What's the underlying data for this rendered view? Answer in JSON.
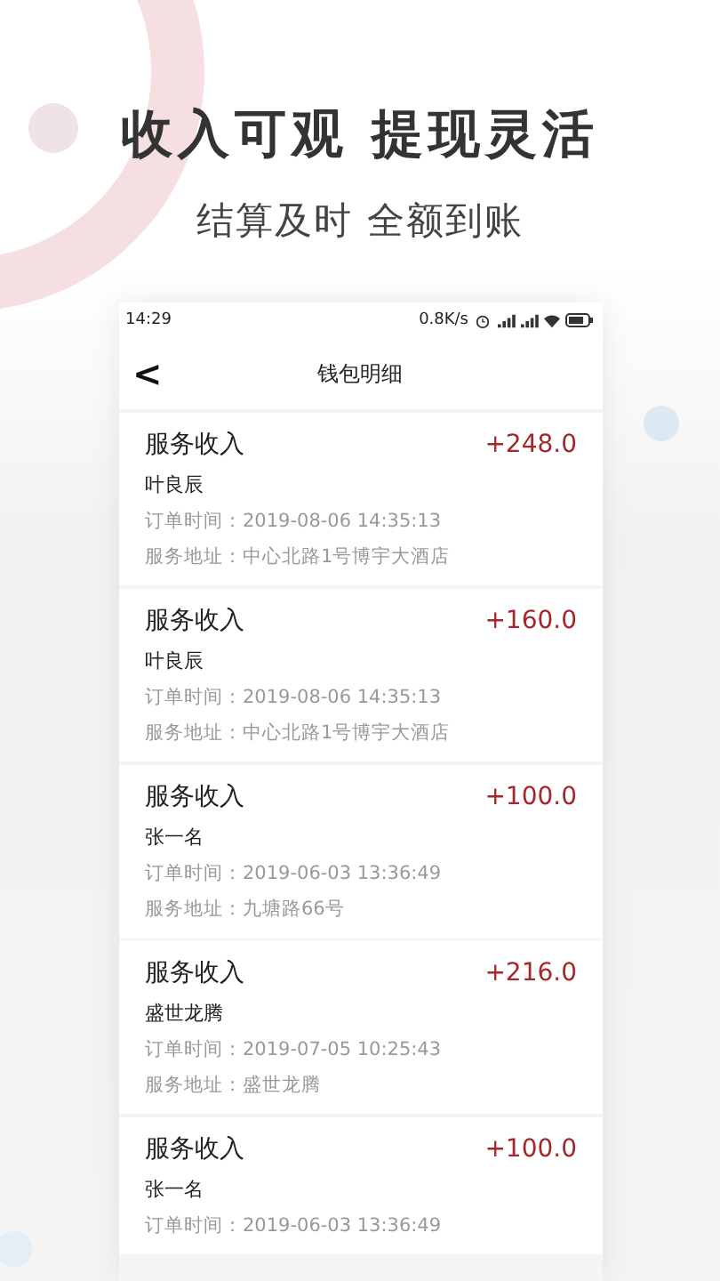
{
  "headline": "收入可观 提现灵活",
  "subheadline": "结算及时 全额到账",
  "status_bar": {
    "time": "14:29",
    "speed": "0.8K/s"
  },
  "nav": {
    "back": "<",
    "title": "钱包明细"
  },
  "records": [
    {
      "type": "服务收入",
      "amount": "+248.0",
      "name": "叶良辰",
      "time": "订单时间：2019-08-06 14:35:13",
      "address": "服务地址：中心北路1号博宇大酒店"
    },
    {
      "type": "服务收入",
      "amount": "+160.0",
      "name": "叶良辰",
      "time": "订单时间：2019-08-06 14:35:13",
      "address": "服务地址：中心北路1号博宇大酒店"
    },
    {
      "type": "服务收入",
      "amount": "+100.0",
      "name": "张一名",
      "time": "订单时间：2019-06-03 13:36:49",
      "address": "服务地址：九塘路66号"
    },
    {
      "type": "服务收入",
      "amount": "+216.0",
      "name": "盛世龙腾",
      "time": "订单时间：2019-07-05 10:25:43",
      "address": "服务地址：盛世龙腾"
    },
    {
      "type": "服务收入",
      "amount": "+100.0",
      "name": "张一名",
      "time": "订单时间：2019-06-03 13:36:49"
    }
  ]
}
